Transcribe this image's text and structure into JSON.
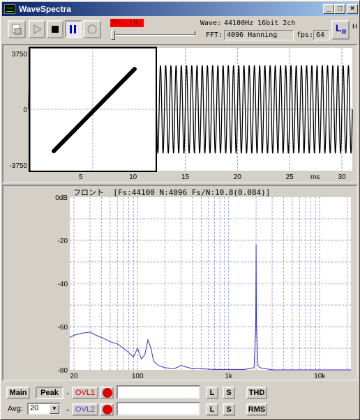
{
  "window": {
    "title": "WaveSpectra",
    "min": "_",
    "max": "□",
    "close": "×"
  },
  "toolbar": {
    "rec_label": "Rec.In.",
    "wave_label": "Wave:",
    "wave_value": "44100Hz 16bit 2ch",
    "fft_label": "FFT:",
    "fft_value": "4096 Hanning",
    "fps_label": "fps:",
    "fps_value": "64",
    "lr_label": "L",
    "lr_sub": "R",
    "side_h": "H"
  },
  "wave": {
    "ymax": "3750",
    "yzero": "0",
    "ymin": "-3750",
    "xticks": [
      "5",
      "10",
      "15",
      "20",
      "25",
      "30"
    ],
    "xunit": "ms"
  },
  "spectrum": {
    "header": "フロント  [Fs:44100 N:4096 Fs/N:10.8(0.084)]",
    "yticks": [
      "0dB",
      "-20",
      "-40",
      "-60",
      "-80"
    ],
    "xticks": [
      "20",
      "100",
      "1k",
      "10k"
    ]
  },
  "bottom": {
    "main_label": "Main",
    "peak_label": "Peak",
    "dash1": "-",
    "dash2": "-",
    "ovl1_label": "OVL1",
    "ovl2_label": "OVL2",
    "avg_label": "Avg:",
    "avg_value": "20",
    "l1": "L",
    "s1": "S",
    "l2": "L",
    "s2": "S",
    "thd_label": "THD",
    "rms_label": "RMS",
    "colors": {
      "ovl1": "#d00000",
      "ovl2": "#4040d0"
    }
  },
  "chart_data": [
    {
      "type": "line",
      "title": "",
      "xlabel": "ms",
      "ylabel": "",
      "xlim": [
        0,
        31
      ],
      "ylim": [
        -3750,
        3750
      ],
      "x_ticks": [
        5,
        10,
        15,
        20,
        25,
        30
      ],
      "series": [
        {
          "frequency_cycles_per_ms": 2.0,
          "amplitude": 2700
        }
      ]
    },
    {
      "type": "line",
      "title": "フロント  [Fs:44100 N:4096 Fs/N:10.8(0.084)]",
      "xlabel": "",
      "ylabel": "dB",
      "xscale": "log",
      "xlim": [
        18,
        22000
      ],
      "ylim": [
        -80,
        0
      ],
      "series": [
        {
          "x": [
            18,
            20,
            25,
            30,
            35,
            40,
            45,
            50,
            60,
            70,
            80,
            90,
            100,
            110,
            120,
            130,
            140,
            150,
            170,
            200,
            250,
            300,
            400,
            500,
            700,
            1000,
            1500,
            1900,
            1980,
            2000,
            2020,
            2100,
            2200,
            3000,
            5000,
            10000,
            22000
          ],
          "y": [
            -65,
            -64,
            -63,
            -62.5,
            -64,
            -65,
            -66,
            -67,
            -68,
            -70,
            -72,
            -74,
            -70,
            -75,
            -73,
            -66,
            -70,
            -76,
            -78,
            -79,
            -79.5,
            -78,
            -79.5,
            -79.5,
            -79.8,
            -79.8,
            -79.8,
            -79,
            -60,
            -22,
            -60,
            -78,
            -79,
            -80,
            -80,
            -80,
            -80
          ]
        }
      ]
    }
  ]
}
